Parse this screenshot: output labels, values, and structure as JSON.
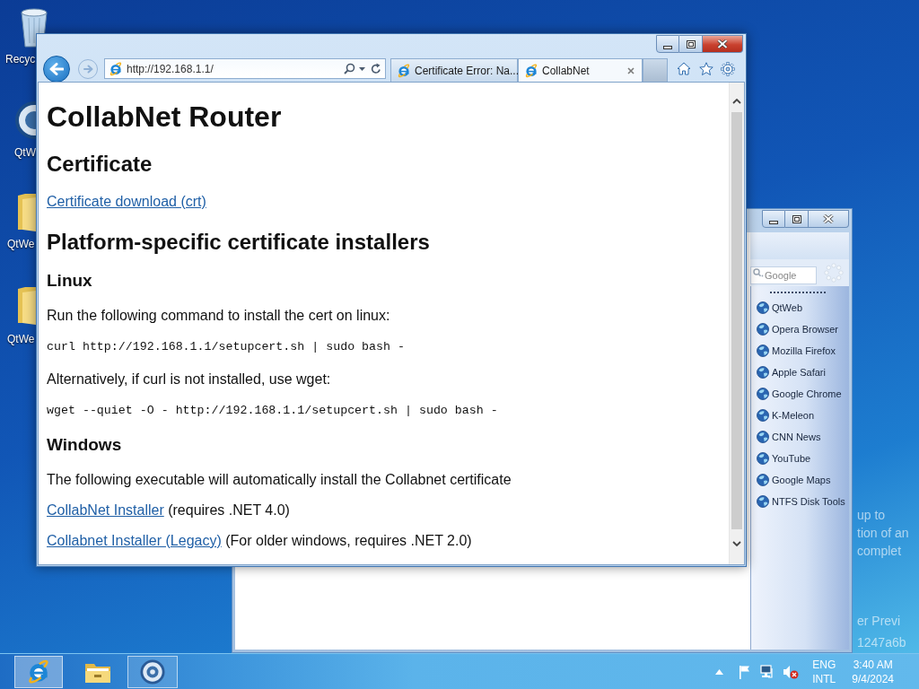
{
  "desktop_icons": [
    {
      "kind": "recycle-bin",
      "label": "Recyc"
    },
    {
      "kind": "qtweb",
      "label": "QtW"
    },
    {
      "kind": "folder",
      "label": "QtWe"
    },
    {
      "kind": "folder",
      "label": "QtWe"
    }
  ],
  "launcher_window": {
    "active": false,
    "search": {
      "placeholder": "Google"
    },
    "items": [
      {
        "label": "QtWeb"
      },
      {
        "label": "Opera Browser"
      },
      {
        "label": "Mozilla Firefox"
      },
      {
        "label": "Apple Safari"
      },
      {
        "label": "Google Chrome"
      },
      {
        "label": "K-Meleon"
      },
      {
        "label": "CNN News"
      },
      {
        "label": "YouTube"
      },
      {
        "label": "Google Maps"
      },
      {
        "label": "NTFS Disk Tools"
      }
    ]
  },
  "browser_window": {
    "active": true,
    "address": "http://192.168.1.1/",
    "tabs": [
      {
        "title": "Certificate Error: Na...",
        "selected": false
      },
      {
        "title": "CollabNet",
        "selected": true
      }
    ],
    "page": [
      {
        "kind": "h1",
        "text": "CollabNet Router"
      },
      {
        "kind": "h2",
        "text": "Certificate"
      },
      {
        "kind": "link",
        "text": "Certificate download (crt)"
      },
      {
        "kind": "h2",
        "text": "Platform-specific certificate installers"
      },
      {
        "kind": "h3",
        "text": "Linux"
      },
      {
        "kind": "p",
        "text": "Run the following command to install the cert on linux:"
      },
      {
        "kind": "code",
        "text": "curl http://192.168.1.1/setupcert.sh | sudo bash -"
      },
      {
        "kind": "p",
        "text": "Alternatively, if curl is not installed, use wget:"
      },
      {
        "kind": "code",
        "text": "wget --quiet -O - http://192.168.1.1/setupcert.sh | sudo bash -"
      },
      {
        "kind": "h3",
        "text": "Windows"
      },
      {
        "kind": "p",
        "text": "The following executable will automatically install the Collabnet certificate"
      },
      {
        "kind": "link-note",
        "link": "CollabNet Installer",
        "note": "(requires .NET 4.0)"
      },
      {
        "kind": "link-note",
        "link": "Collabnet Installer (Legacy)",
        "note": "(For older windows, requires .NET 2.0)"
      }
    ]
  },
  "desktop_text": [
    "up to",
    "tion of an",
    "complet",
    "er Previ",
    "1247a6b"
  ],
  "taskbar": {
    "apps": [
      {
        "kind": "ie",
        "running": true,
        "active": true
      },
      {
        "kind": "explorer",
        "running": false,
        "active": false
      },
      {
        "kind": "qtweb",
        "running": true,
        "active": false
      }
    ],
    "tray": {
      "language": "ENG",
      "layout": "INTL",
      "time": "3:40 AM",
      "date": "9/4/2024"
    }
  }
}
